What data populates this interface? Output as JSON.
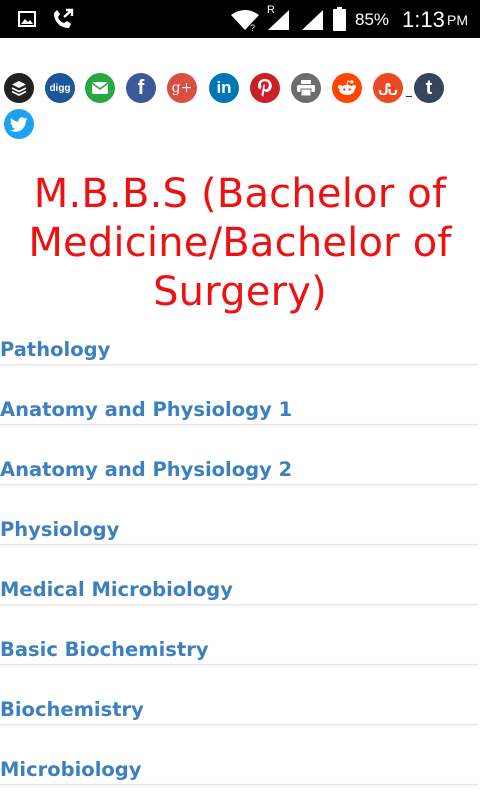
{
  "status_bar": {
    "roaming_label": "R",
    "battery_percent": "85%",
    "time": "1:13",
    "time_suffix": "PM",
    "icons": [
      "gallery-icon",
      "missed-call-icon",
      "wifi-icon",
      "signal-icon",
      "signal-icon",
      "battery-icon"
    ]
  },
  "share_buttons": [
    {
      "name": "buffer",
      "color": "#222222"
    },
    {
      "name": "digg",
      "label": "digg",
      "color": "#1a5899"
    },
    {
      "name": "email",
      "color": "#27a844"
    },
    {
      "name": "facebook",
      "label": "f",
      "color": "#3b5998"
    },
    {
      "name": "google-plus",
      "label": "g+",
      "color": "#dc4e41"
    },
    {
      "name": "linkedin",
      "label": "in",
      "color": "#0077b5"
    },
    {
      "name": "pinterest",
      "color": "#cb2027"
    },
    {
      "name": "print",
      "color": "#6d6d6d"
    },
    {
      "name": "reddit",
      "color": "#ff4500"
    },
    {
      "name": "stumbleupon",
      "color": "#eb4823"
    },
    {
      "name": "tumblr",
      "label": "t",
      "color": "#35465c"
    },
    {
      "name": "twitter",
      "color": "#1da1f2"
    }
  ],
  "page": {
    "title_lines": [
      "M.B.B.S (Bachelor of",
      "Medicine/Bachelor of",
      "Surgery)"
    ]
  },
  "subjects": [
    "Pathology",
    "Anatomy and Physiology 1",
    "Anatomy and Physiology 2",
    "Physiology",
    "Medical Microbiology",
    "Basic Biochemistry",
    "Biochemistry",
    "Microbiology"
  ]
}
